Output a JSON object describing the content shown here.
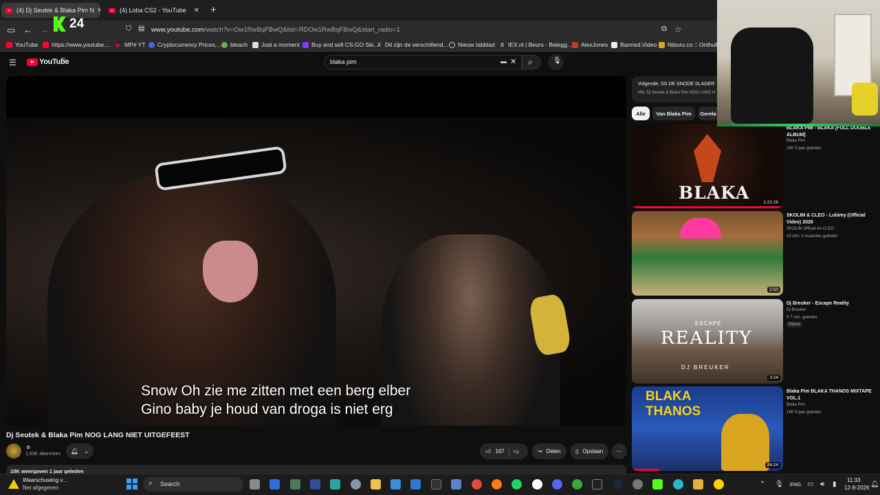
{
  "browser": {
    "tabs": [
      {
        "label": "(4) Dj Seutek & Blaka Pim N"
      },
      {
        "label": "(4) Loba CS2 - YouTube"
      }
    ],
    "kick_count": "24",
    "url_host": "www.youtube.com",
    "url_path": "/watch?v=Ow1RwBqFBwQ&list=RDOw1RwBqFBwQ&start_radio=1",
    "bookmarks": [
      "YouTube",
      "https://www.youtube....",
      "MP# YT",
      "Cryptocurrency Prices,...",
      "bleach",
      "Just a moment",
      "Buy and sell CS:GO Ski...",
      "Dit zijn de verschillend...",
      "Nieuw tabblad",
      "IEX.nl | Beurs - Belegg...",
      "AlexJones",
      "Banned.Video",
      "Niburu.co :: Onthulle"
    ]
  },
  "youtube": {
    "logo_text": "YouTube",
    "logo_sup": "NL",
    "search_value": "blaka pim"
  },
  "player": {
    "caption_line1": "Snow Oh zie me zitten met een berg elber",
    "caption_line2": "Gino baby je houd van droga is niet erg"
  },
  "video": {
    "title": "Dj Seutek & Blaka Pim NOG LANG NIET UITGEFEEST",
    "subscribers": "1,63K abonnees",
    "likes": "167",
    "share_label": "Delen",
    "save_label": "Opslaan",
    "views_meta": "10K weergaven  1 jaar geleden"
  },
  "sidebar": {
    "upnext_title": "Volgende: SS DE SNODE SLAGER",
    "upnext_sub": "Mix: Dj Seutek & Blaka Pim NOG LANG N",
    "chips": [
      "Alle",
      "Van Blaka Pim",
      "Gerela"
    ],
    "recommendations": [
      {
        "title": "BLAKA PIM - BLAKA [FULL DOUBLE ALBUM]",
        "channel": "Blaka Pim",
        "meta": "18K  5 jaar geleden",
        "duration": "1:22:28"
      },
      {
        "title": "SKOLIM & CLEO - Lubimy  (Official Video) 2026",
        "channel": "SKOLIM Official en CLEO",
        "meta": "15 mln.  2 maanden geleden",
        "duration": "2:50"
      },
      {
        "title": "Dj Breuker - Escape Reality",
        "channel": "Dj Breuker",
        "meta": "0  7 min. geleden",
        "duration": "3:24",
        "badge": "Nieuw"
      },
      {
        "title": "Blaka Pim BLAKA THANOS MIXTAPE VOL.1",
        "channel": "Blaka Pim",
        "meta": "16K  6 jaar geleden",
        "duration": "26:24"
      }
    ],
    "thumb_texts": {
      "t1": "BLAKA",
      "t3_small": "ESCAPE",
      "t3_big": "REALITY",
      "t3_artist": "DJ BREUKER",
      "t4_line1": "BLAKA",
      "t4_line2": "THANOS"
    }
  },
  "taskbar": {
    "notification_title": "Waarschuwing v...",
    "notification_sub": "Net afgegeven",
    "search_label": "Search",
    "language": "ENG",
    "time": "11:33",
    "date": "12-8-2026"
  }
}
